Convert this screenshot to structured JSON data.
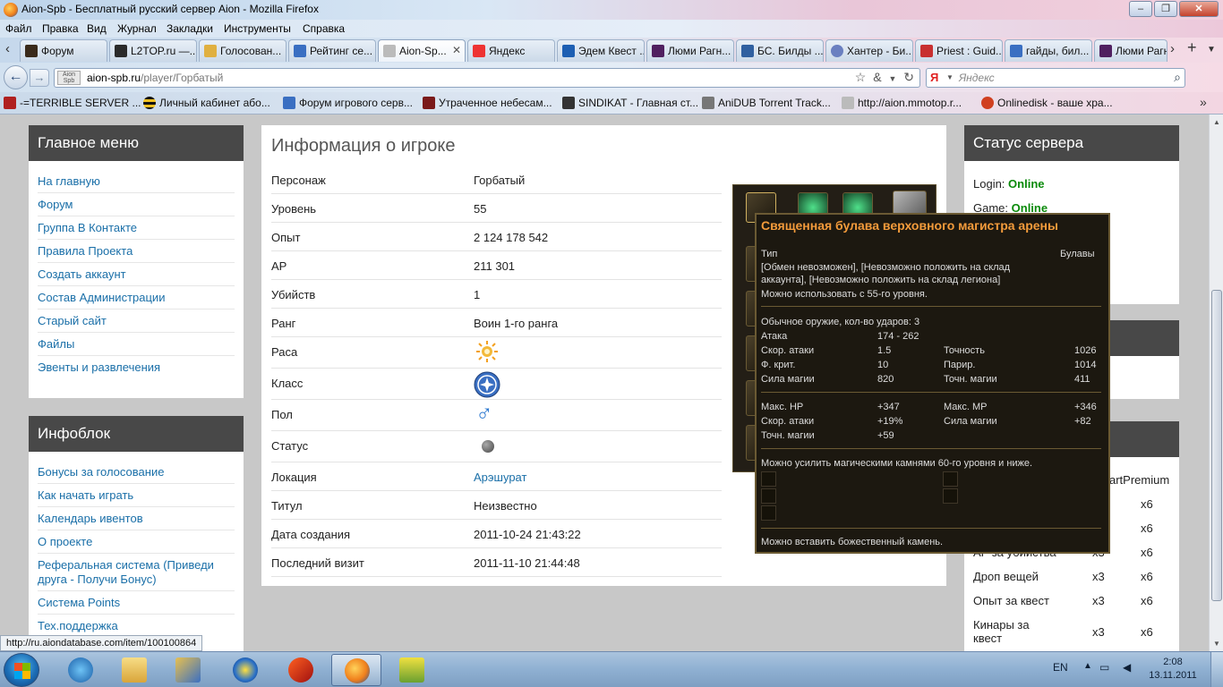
{
  "window": {
    "title": "Aion-Spb - Бесплатный русский сервер Aion - Mozilla Firefox"
  },
  "menu": [
    "Файл",
    "Правка",
    "Вид",
    "Журнал",
    "Закладки",
    "Инструменты",
    "Справка"
  ],
  "tabs": [
    {
      "label": "Форум"
    },
    {
      "label": "L2TOP.ru —..."
    },
    {
      "label": "Голосован..."
    },
    {
      "label": "Рейтинг се..."
    },
    {
      "label": "Aion-Sp..."
    },
    {
      "label": "Яндекс"
    },
    {
      "label": "Эдем Квест ..."
    },
    {
      "label": "Люми Рагн..."
    },
    {
      "label": "БС. Билды ..."
    },
    {
      "label": "Хантер - Би..."
    },
    {
      "label": "Priest : Guid..."
    },
    {
      "label": "гайды, бил..."
    },
    {
      "label": "Люми Рагн..."
    }
  ],
  "nav": {
    "url_host": "aion-spb.ru",
    "url_path": "/player/Горбатый",
    "search_placeholder": "Яндекс",
    "site_icon_text": "Aion Spb"
  },
  "bookmarks": [
    {
      "label": "-=TERRIBLE SERVER ..."
    },
    {
      "label": "Личный кабинет або..."
    },
    {
      "label": "Форум игрового серв..."
    },
    {
      "label": "Утраченное небесам..."
    },
    {
      "label": "SINDIKAT - Главная ст..."
    },
    {
      "label": "AniDUB Torrent Track..."
    },
    {
      "label": "http://aion.mmotop.r..."
    },
    {
      "label": "Onlinedisk - ваше хра..."
    }
  ],
  "main_menu": {
    "title": "Главное меню",
    "items": [
      "На главную",
      "Форум",
      "Группа В Контакте",
      "Правила Проекта",
      "Создать аккаунт",
      "Состав Администрации",
      "Старый сайт",
      "Файлы",
      "Эвенты и развлечения"
    ]
  },
  "infoblock": {
    "title": "Инфоблок",
    "items": [
      "Бонусы за голосование",
      "Как начать играть",
      "Календарь ивентов",
      "О проекте",
      "Реферальная система (Приведи друга - Получи Бонус)",
      "Система Points",
      "Тех.поддержка"
    ]
  },
  "player": {
    "title": "Информация о игроке",
    "rows": [
      {
        "key": "Персонаж",
        "value": "Горбатый"
      },
      {
        "key": "Уровень",
        "value": "55"
      },
      {
        "key": "Опыт",
        "value": "2 124 178 542"
      },
      {
        "key": "AP",
        "value": "211 301"
      },
      {
        "key": "Убийств",
        "value": "1"
      },
      {
        "key": "Ранг",
        "value": "Воин 1-го ранга"
      },
      {
        "key": "Раса",
        "value": ""
      },
      {
        "key": "Класс",
        "value": ""
      },
      {
        "key": "Пол",
        "value": "♂"
      },
      {
        "key": "Статус",
        "value": ""
      },
      {
        "key": "Локация",
        "value": "Арэшурат"
      },
      {
        "key": "Титул",
        "value": "Неизвестно"
      },
      {
        "key": "Дата создания",
        "value": "2011-10-24 21:43:22"
      },
      {
        "key": "Последний визит",
        "value": "2011-11-10 21:44:48"
      }
    ]
  },
  "tooltip": {
    "title": "Священная булава верховного магистра арены",
    "type_label": "Тип",
    "type_value": "Булавы",
    "restrictions": "[Обмен невозможен], [Невозможно положить на склад аккаунта], [Невозможно положить на склад легиона]",
    "level_req": "Можно использовать с 55-го уровня.",
    "weapon_line": "Обычное оружие, кол-во ударов: 3",
    "stats": [
      {
        "k": "Атака",
        "v": "174 - 262"
      },
      {
        "k": "Скор. атаки",
        "v": "1.5"
      },
      {
        "k": "Ф. крит.",
        "v": "10"
      },
      {
        "k": "Сила магии",
        "v": "820"
      }
    ],
    "stats_right": [
      {
        "k": "Точность",
        "v": "1026"
      },
      {
        "k": "Парир.",
        "v": "1014"
      },
      {
        "k": "Точн. магии",
        "v": "411"
      }
    ],
    "bonus_left": [
      {
        "k": "Макс. HP",
        "v": "+347"
      },
      {
        "k": "Скор. атаки",
        "v": "+19%"
      },
      {
        "k": "Точн. магии",
        "v": "+59"
      }
    ],
    "bonus_right": [
      {
        "k": "Макс. MP",
        "v": "+346"
      },
      {
        "k": "Сила магии",
        "v": "+82"
      }
    ],
    "manastone_text": "Можно усилить магическими камнями 60-го уровня и ниже.",
    "godstone_text": "Можно вставить божественный камень."
  },
  "server_status": {
    "title": "Статус сервера",
    "login_label": "Login:",
    "login_value": "Online",
    "game_label": "Game:",
    "game_value": "Online"
  },
  "rates": {
    "header_partial": "artPremium",
    "rows": [
      {
        "label": "",
        "v1": "",
        "v2": "x6"
      },
      {
        "label": "",
        "v1": "",
        "v2": "x6"
      },
      {
        "label": "AP за убийства",
        "v1": "x3",
        "v2": "x6"
      },
      {
        "label": "Дроп вещей",
        "v1": "x3",
        "v2": "x6"
      },
      {
        "label": "Опыт за квест",
        "v1": "x3",
        "v2": "x6"
      },
      {
        "label": "Кинары за квест",
        "v1": "x3",
        "v2": "x6"
      }
    ]
  },
  "status_bar_url": "http://ru.aiondatabase.com/item/100100864",
  "taskbar": {
    "lang": "EN",
    "time": "2:08",
    "date": "13.11.2011"
  }
}
